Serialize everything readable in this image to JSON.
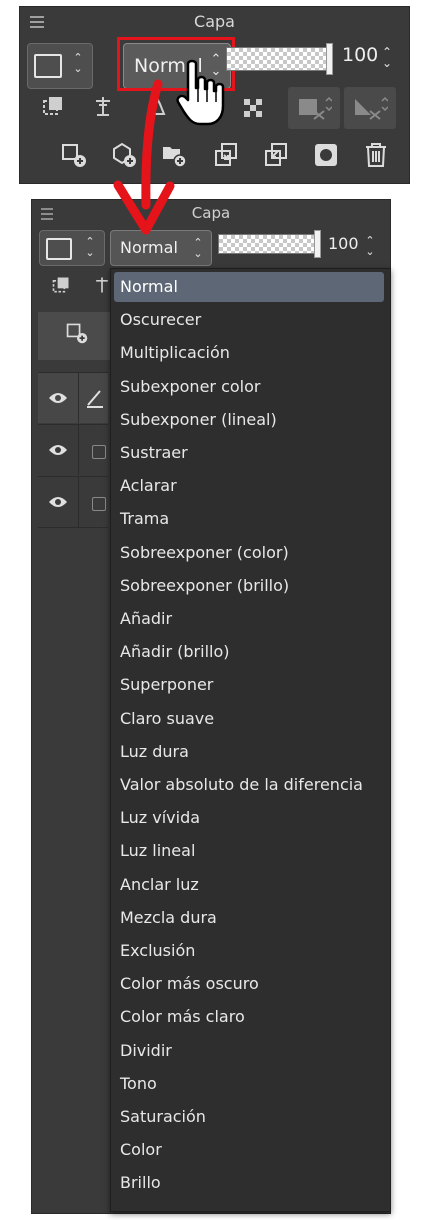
{
  "top_panel": {
    "title": "Capa",
    "blend_mode": "Normal",
    "opacity": "100"
  },
  "bottom_panel": {
    "title": "Capa",
    "blend_mode": "Normal",
    "opacity": "100"
  },
  "dropdown": {
    "items": [
      "Normal",
      "Oscurecer",
      "Multiplicación",
      "Subexponer color",
      "Subexponer (lineal)",
      "Sustraer",
      "Aclarar",
      "Trama",
      "Sobreexponer (color)",
      "Sobreexponer (brillo)",
      "Añadir",
      "Añadir (brillo)",
      "Superponer",
      "Claro suave",
      "Luz dura",
      "Valor absoluto de la diferencia",
      "Luz vívida",
      "Luz lineal",
      "Anclar luz",
      "Mezcla dura",
      "Exclusión",
      "Color más oscuro",
      "Color más claro",
      "Dividir",
      "Tono",
      "Saturación",
      "Color",
      "Brillo"
    ],
    "selected": "Normal"
  },
  "colors": {
    "panel_bg": "#3a3a3a",
    "dropdown_bg": "#2e2e2e",
    "selected_bg": "#5d6775",
    "highlight_red": "#e5141b"
  },
  "icons": {
    "annotation_arrow": "red-arrow-icon",
    "pointer": "hand-pointer-icon"
  }
}
